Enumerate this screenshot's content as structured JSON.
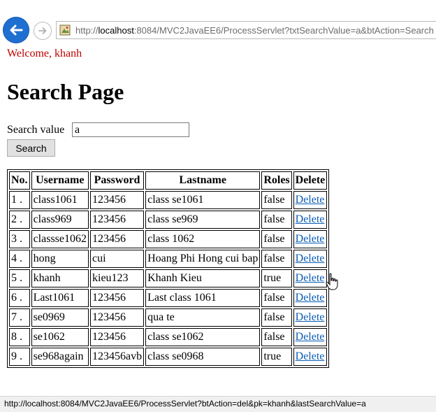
{
  "browser": {
    "url_prefix": "http://",
    "url_host": "localhost",
    "url_rest": ":8084/MVC2JavaEE6/ProcessServlet?txtSearchValue=a&btAction=Search",
    "status_url": "http://localhost:8084/MVC2JavaEE6/ProcessServlet?btAction=del&pk=khanh&lastSearchValue=a"
  },
  "page": {
    "welcome": "Welcome, khanh",
    "title": "Search Page",
    "search_label": "Search value",
    "search_value": "a",
    "search_button": "Search"
  },
  "table": {
    "headers": [
      "No.",
      "Username",
      "Password",
      "Lastname",
      "Roles",
      "Delete"
    ],
    "rows": [
      [
        "1 .",
        "class1061",
        "123456",
        "class se1061",
        "false",
        "Delete"
      ],
      [
        "2 .",
        "class969",
        "123456",
        "class se969",
        "false",
        "Delete"
      ],
      [
        "3 .",
        "classse1062",
        "123456",
        "class 1062",
        "false",
        "Delete"
      ],
      [
        "4 .",
        "hong",
        "cui",
        "Hoang Phi Hong cui bap",
        "false",
        "Delete"
      ],
      [
        "5 .",
        "khanh",
        "kieu123",
        "Khanh Kieu",
        "true",
        "Delete"
      ],
      [
        "6 .",
        "Last1061",
        "123456",
        "Last class 1061",
        "false",
        "Delete"
      ],
      [
        "7 .",
        "se0969",
        "123456",
        "qua te",
        "false",
        "Delete"
      ],
      [
        "8 .",
        "se1062",
        "123456",
        "class se1062",
        "false",
        "Delete"
      ],
      [
        "9 .",
        "se968again",
        "123456avb",
        "class se0968",
        "true",
        "Delete"
      ]
    ]
  },
  "colors": {
    "welcome": "#c00000",
    "link": "#0b5db5",
    "back_button": "#1f6fd1"
  },
  "icons": {
    "back": "back-arrow-icon",
    "forward": "forward-arrow-icon",
    "page": "page-icon",
    "cursor": "hand-pointer-icon"
  }
}
